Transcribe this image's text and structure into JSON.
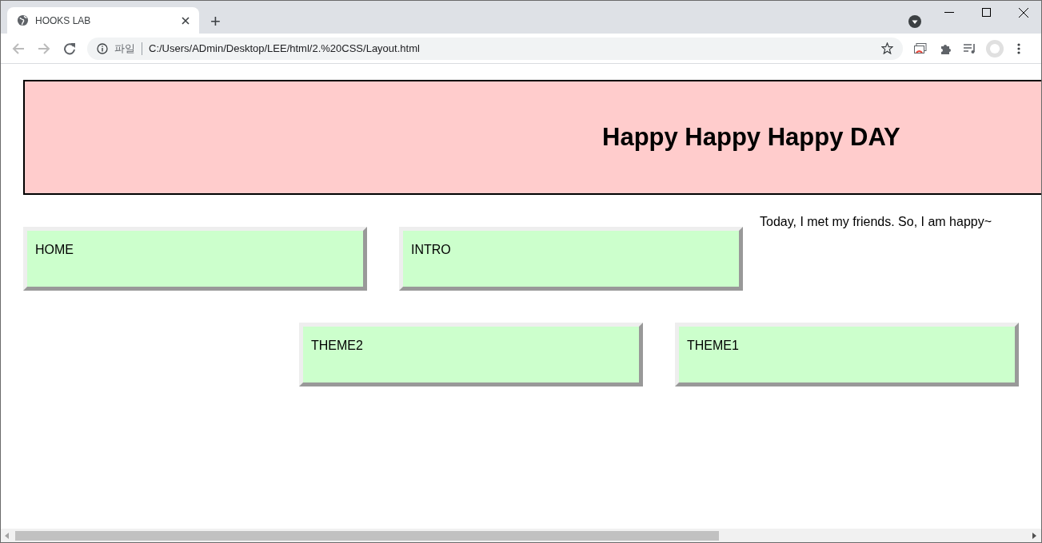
{
  "browser": {
    "tab_title": "HOOKS LAB",
    "new_tab": "+",
    "site_label": "파일",
    "url": "C:/Users/ADmin/Desktop/LEE/html/2.%20CSS/Layout.html"
  },
  "header": {
    "title": "Happy Happy Happy DAY"
  },
  "boxes": [
    {
      "label": "HOME"
    },
    {
      "label": "INTRO"
    },
    {
      "label": "THEME2"
    },
    {
      "label": "THEME1"
    }
  ],
  "paragraph": "Today, I met my friends. So, I am happy~"
}
